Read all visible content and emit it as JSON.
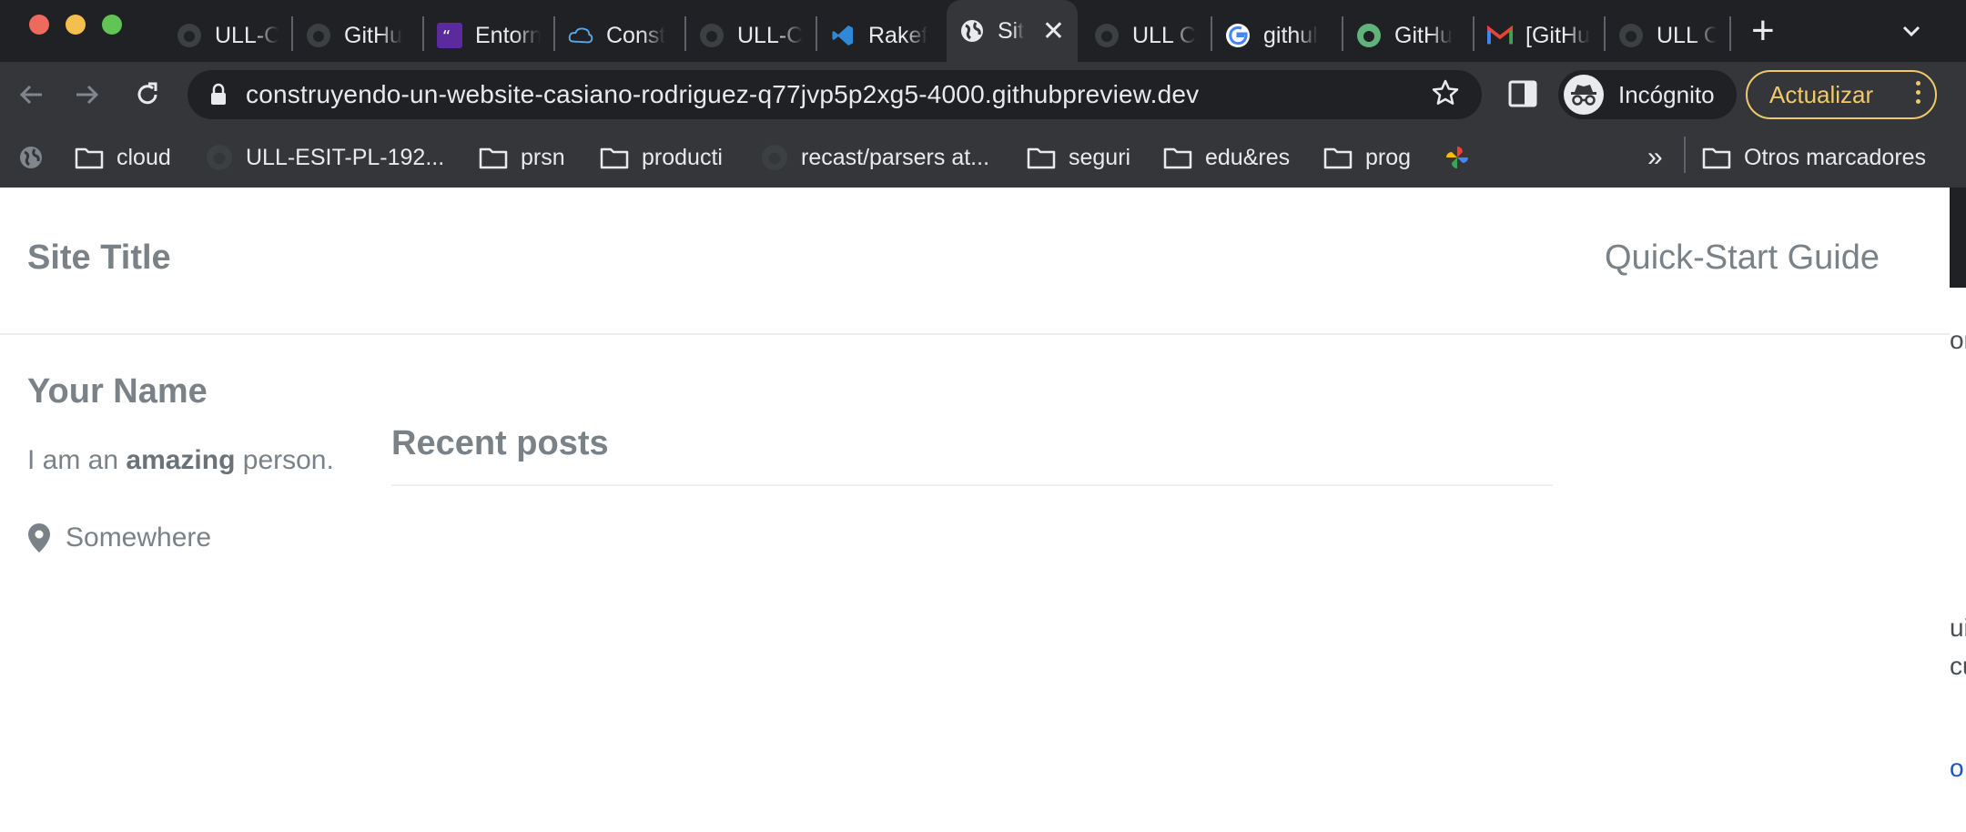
{
  "browser": {
    "tabs": [
      {
        "title": "ULL-C",
        "icon": "github-icon"
      },
      {
        "title": "GitHu",
        "icon": "github-icon"
      },
      {
        "title": "Entorn",
        "icon": "quote-app-icon"
      },
      {
        "title": "Const",
        "icon": "cloud-icon"
      },
      {
        "title": "ULL-C",
        "icon": "github-icon"
      },
      {
        "title": "Rakef",
        "icon": "vscode-icon"
      },
      {
        "title": "Sit",
        "icon": "globe-icon",
        "active": true
      },
      {
        "title": "ULL C",
        "icon": "github-icon"
      },
      {
        "title": "githul",
        "icon": "google-icon"
      },
      {
        "title": "GitHu",
        "icon": "github-green-icon"
      },
      {
        "title": "[GitHu",
        "icon": "gmail-icon"
      },
      {
        "title": "ULL C",
        "icon": "github-icon"
      }
    ],
    "url": "construyendo-un-website-casiano-rodriguez-q77jvp5p2xg5-4000.githubpreview.dev",
    "profile_label": "Incógnito",
    "update_label": "Actualizar",
    "bookmarks": [
      {
        "label": "",
        "icon": "globe-icon"
      },
      {
        "label": "cloud",
        "icon": "folder-icon"
      },
      {
        "label": "ULL-ESIT-PL-192...",
        "icon": "github-icon"
      },
      {
        "label": "prsn",
        "icon": "folder-icon"
      },
      {
        "label": "producti",
        "icon": "folder-icon"
      },
      {
        "label": "recast/parsers at...",
        "icon": "github-icon"
      },
      {
        "label": "seguri",
        "icon": "folder-icon"
      },
      {
        "label": "edu&res",
        "icon": "folder-icon"
      },
      {
        "label": "prog",
        "icon": "folder-icon"
      },
      {
        "label": "",
        "icon": "pinwheel-icon"
      }
    ],
    "overflow_label": "»",
    "other_bookmarks_label": "Otros marcadores",
    "colors": {
      "chrome_dark": "#202124",
      "toolbar": "#35363a",
      "update_accent": "#f1c96b"
    }
  },
  "site": {
    "title": "Site Title",
    "nav_link": "Quick-Start Guide",
    "author": {
      "name": "Your Name",
      "bio_prefix": "I am an ",
      "bio_bold": "amazing",
      "bio_suffix": " person.",
      "location": "Somewhere"
    },
    "recent_posts_heading": "Recent posts",
    "text_color": "#7a8288"
  },
  "edge_fragments": [
    "or",
    "ui",
    "cu",
    "o,"
  ]
}
